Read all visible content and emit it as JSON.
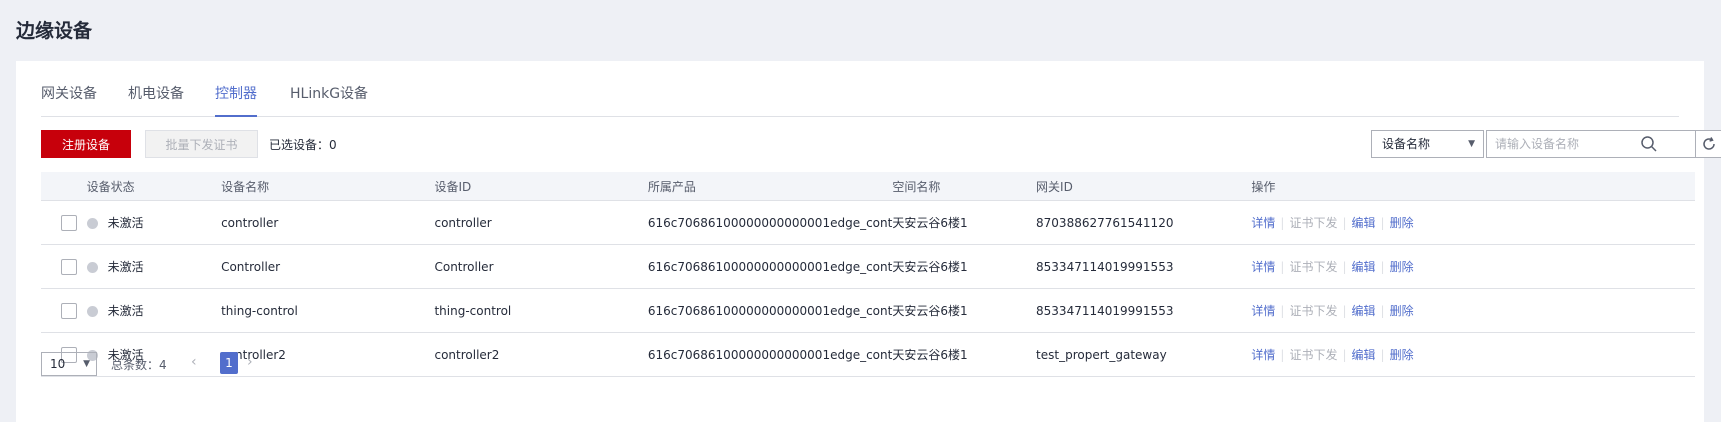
{
  "page": {
    "title": "边缘设备"
  },
  "tabs": [
    {
      "label": "网关设备"
    },
    {
      "label": "机电设备"
    },
    {
      "label": "控制器"
    },
    {
      "label": "HLinkG设备"
    }
  ],
  "active_tab": "控制器",
  "toolbar": {
    "register_label": "注册设备",
    "batch_cert_label": "批量下发证书",
    "selected_label": "已选设备：0",
    "filter_select_value": "设备名称",
    "search_placeholder": "请输入设备名称"
  },
  "table": {
    "headers": [
      "设备状态",
      "设备名称",
      "设备ID",
      "所属产品",
      "空间名称",
      "网关ID",
      "操作"
    ],
    "rows": [
      {
        "status": "未激活",
        "name": "controller",
        "id": "controller",
        "product": "616c70686100000000000001edge_cont",
        "space": "天安云谷6楼1",
        "gateway": "870388627761541120"
      },
      {
        "status": "未激活",
        "name": "Controller",
        "id": "Controller",
        "product": "616c70686100000000000001edge_cont",
        "space": "天安云谷6楼1",
        "gateway": "853347114019991553"
      },
      {
        "status": "未激活",
        "name": "thing-control",
        "id": "thing-control",
        "product": "616c70686100000000000001edge_cont",
        "space": "天安云谷6楼1",
        "gateway": "853347114019991553"
      },
      {
        "status": "未激活",
        "name": "controller2",
        "id": "controller2",
        "product": "616c70686100000000000001edge_cont",
        "space": "天安云谷6楼1",
        "gateway": "test_propert_gateway"
      }
    ],
    "actions": {
      "detail": "详情",
      "cert": "证书下发",
      "edit": "编辑",
      "delete": "删除"
    }
  },
  "pagination": {
    "page_size": "10",
    "total_label": "总条数：4",
    "current_page": "1"
  },
  "colors": {
    "primary_red": "#c7000b",
    "accent_blue": "#526ecc",
    "inactive_dot": "#c9ccd4"
  }
}
